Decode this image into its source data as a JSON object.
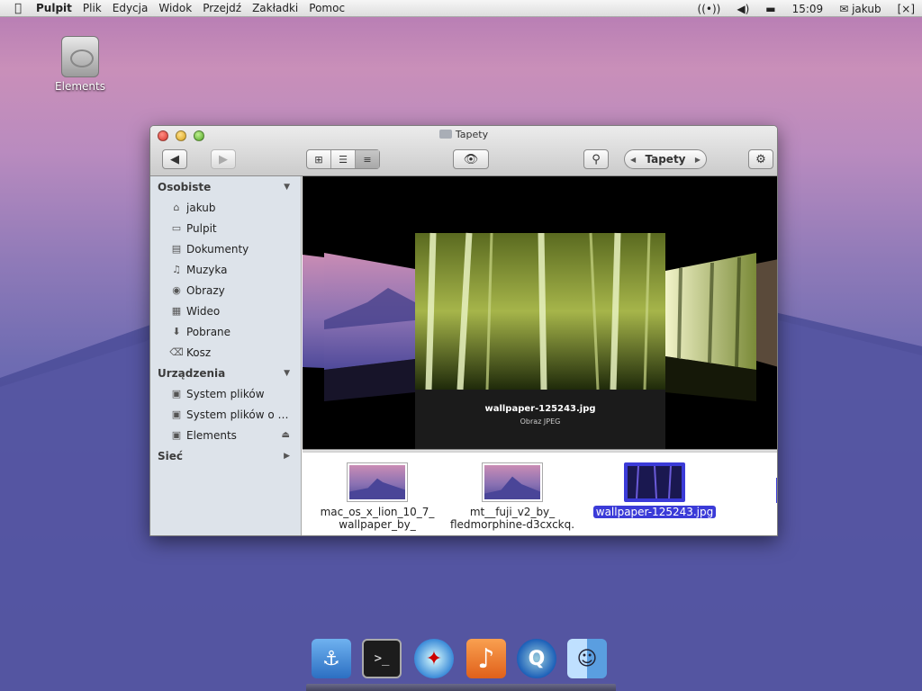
{
  "menubar": {
    "apple": "",
    "app_name": "Pulpit",
    "menus": [
      "Plik",
      "Edycja",
      "Widok",
      "Przejdź",
      "Zakładki",
      "Pomoc"
    ],
    "clock": "15:09",
    "user": "jakub",
    "icons": [
      "wireless-icon",
      "volume-icon",
      "messages-icon",
      "user-icon",
      "session-icon"
    ]
  },
  "desktop": {
    "icon_label": "Elements"
  },
  "window": {
    "title": "Tapety",
    "path_popup": "Tapety",
    "toolbar": {
      "back": "◀",
      "forward": "▶",
      "view_icons": "⊞",
      "view_list": "☰",
      "view_columns": "≡",
      "preview": "👁",
      "search": "⚲",
      "gear": "⚙"
    },
    "sidebar": {
      "sections": [
        {
          "title": "Osobiste",
          "toggle": "▼",
          "items": [
            {
              "label": "jakub",
              "icon": "home-icon",
              "glyph": "⌂"
            },
            {
              "label": "Pulpit",
              "icon": "desktop-icon",
              "glyph": "▭"
            },
            {
              "label": "Dokumenty",
              "icon": "documents-icon",
              "glyph": "▤"
            },
            {
              "label": "Muzyka",
              "icon": "music-icon",
              "glyph": "♫"
            },
            {
              "label": "Obrazy",
              "icon": "camera-icon",
              "glyph": "◉"
            },
            {
              "label": "Wideo",
              "icon": "film-icon",
              "glyph": "▦"
            },
            {
              "label": "Pobrane",
              "icon": "download-icon",
              "glyph": "⬇"
            },
            {
              "label": "Kosz",
              "icon": "trash-icon",
              "glyph": "⌫"
            }
          ]
        },
        {
          "title": "Urządzenia",
          "toggle": "▼",
          "items": [
            {
              "label": "System plików",
              "icon": "drive-icon",
              "glyph": "▣"
            },
            {
              "label": "System plików o ro...",
              "icon": "drive-icon",
              "glyph": "▣"
            },
            {
              "label": "Elements",
              "icon": "drive-icon",
              "glyph": "▣",
              "eject": "⏏"
            }
          ]
        },
        {
          "title": "Sieć",
          "toggle": "▶",
          "items": []
        }
      ]
    },
    "coverflow": {
      "selected_name": "wallpaper-125243.jpg",
      "selected_type": "Obraz JPEG"
    },
    "files": [
      {
        "name": "mac_os_x_lion_10_7_ wallpaper_by_",
        "selected": false
      },
      {
        "name": "mt__fuji_v2_by_ fledmorphine-d3cxckq.",
        "selected": false
      },
      {
        "name": "wallpaper-125243.jpg",
        "selected": true
      }
    ]
  },
  "dock": {
    "items": [
      {
        "name": "anchor-app-icon",
        "glyph": "⚓",
        "bg": "#4a90d9"
      },
      {
        "name": "terminal-icon",
        "glyph": ">_",
        "bg": "#222"
      },
      {
        "name": "safari-icon",
        "glyph": "✦",
        "bg": "#2a7bd6"
      },
      {
        "name": "music-app-icon",
        "glyph": "♪",
        "bg": "#f07a22"
      },
      {
        "name": "quicktime-icon",
        "glyph": "Q",
        "bg": "#1b5fb8"
      },
      {
        "name": "finder-icon",
        "glyph": "☺",
        "bg": "#6aa5e0"
      }
    ]
  },
  "colors": {
    "selection": "#3b3bd8",
    "sidebar_bg": "#dde3ea"
  }
}
